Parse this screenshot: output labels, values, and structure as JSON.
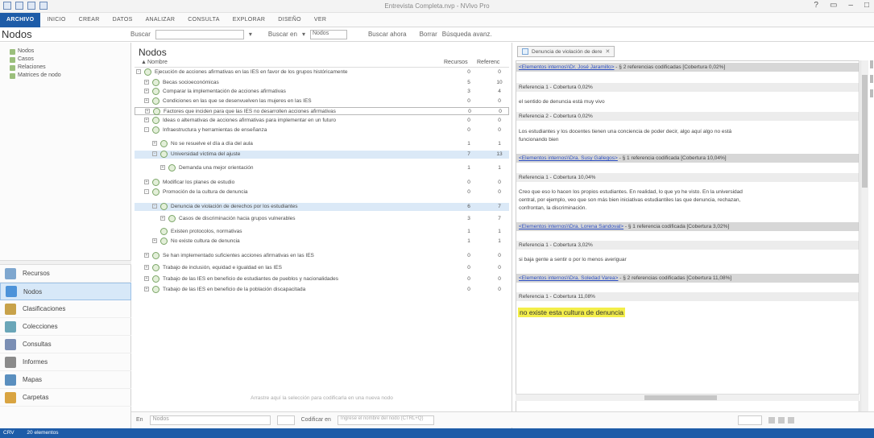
{
  "titlebar": {
    "title": "Entrevista Completa.nvp - NVivo Pro"
  },
  "ribbon": {
    "tabs": [
      "ARCHIVO",
      "INICIO",
      "CREAR",
      "DATOS",
      "ANALIZAR",
      "CONSULTA",
      "EXPLORAR",
      "DISEÑO",
      "VER"
    ]
  },
  "toolbar": {
    "heading": "Nodos",
    "search_label": "Buscar",
    "search_in_label": "Buscar en",
    "search_scope": "Nodos",
    "find_now": "Buscar ahora",
    "clear": "Borrar",
    "advanced": "Búsqueda avanz."
  },
  "leftnav": {
    "tree": [
      "Nodos",
      "Casos",
      "Relaciones",
      "Matrices de nodo"
    ],
    "nav": [
      "Recursos",
      "Nodos",
      "Clasificaciones",
      "Colecciones",
      "Consultas",
      "Informes",
      "Mapas",
      "Carpetas"
    ]
  },
  "center": {
    "title": "Nodos",
    "col_name": "Nombre",
    "col_resources": "Recursos",
    "col_references": "Referenc",
    "empty_hint": "Arrastre aquí la selección para codificarla en una nueva nodo",
    "bottom_label": "En",
    "bottom_value": "Nodos",
    "code_button": "Codificar en",
    "code_hint": "Ingrese el nombre del nodo (CTRL+Q)"
  },
  "nodes": [
    {
      "label": "Ejecución de acciones afirmativas en las IES en favor de los grupos históricamente",
      "res": "0",
      "ref": "0",
      "level": 0,
      "exp": "-"
    },
    {
      "label": "Becas socioeconómicas",
      "res": "5",
      "ref": "10",
      "level": 1,
      "exp": "+"
    },
    {
      "label": "Comparar la implementación de acciones afirmativas",
      "res": "3",
      "ref": "4",
      "level": 1,
      "exp": "+"
    },
    {
      "label": "Condiciones en las que se desenvuelven las mujeres en las IES",
      "res": "0",
      "ref": "0",
      "level": 1,
      "exp": "+"
    },
    {
      "label": "Factores que inciden para que las IES no desarrollen acciones afirmativas",
      "res": "0",
      "ref": "0",
      "level": 1,
      "exp": "+"
    },
    {
      "label": "Ideas o alternativas de acciones afirmativas para implementar en un futuro",
      "res": "0",
      "ref": "0",
      "level": 1,
      "exp": "+"
    },
    {
      "label": "Infraestructura y herramientas de enseñanza",
      "res": "0",
      "ref": "0",
      "level": 1,
      "exp": "-"
    },
    {
      "label": "No se resuelve el día a día del aula",
      "res": "1",
      "ref": "1",
      "level": 2,
      "exp": "+"
    },
    {
      "label": "Universidad víctima del ajuste",
      "res": "7",
      "ref": "13",
      "level": 2,
      "exp": "-"
    },
    {
      "label": "Demanda una mejor orientación",
      "res": "1",
      "ref": "1",
      "level": 3,
      "exp": "+"
    },
    {
      "label": "Modificar los planes de estudio",
      "res": "0",
      "ref": "0",
      "level": 1,
      "exp": "+"
    },
    {
      "label": "Promoción de la cultura de denuncia",
      "res": "0",
      "ref": "0",
      "level": 1,
      "exp": "-"
    },
    {
      "label": "Denuncia de violación de derechos por los estudiantes",
      "res": "6",
      "ref": "7",
      "level": 2,
      "exp": "-"
    },
    {
      "label": "Casos de discriminación hacia grupos vulnerables",
      "res": "3",
      "ref": "7",
      "level": 3,
      "exp": "+"
    },
    {
      "label": "Existen protocolos, normativas",
      "res": "1",
      "ref": "1",
      "level": 2,
      "exp": ""
    },
    {
      "label": "No existe cultura de denuncia",
      "res": "1",
      "ref": "1",
      "level": 2,
      "exp": "+"
    },
    {
      "label": "Se han implementado suficientes acciones afirmativas en las IES",
      "res": "0",
      "ref": "0",
      "level": 1,
      "exp": "+"
    },
    {
      "label": "Trabajo de inclusión, equidad e igualdad en las IES",
      "res": "0",
      "ref": "0",
      "level": 1,
      "exp": "+"
    },
    {
      "label": "Trabajo de las IES en beneficio de estudiantes de pueblos y nacionalidades",
      "res": "0",
      "ref": "0",
      "level": 1,
      "exp": "+"
    },
    {
      "label": "Trabajo de las IES en beneficio de la población discapacitada",
      "res": "0",
      "ref": "0",
      "level": 1,
      "exp": "+"
    }
  ],
  "right": {
    "tab_label": "Denuncia de violación de dere",
    "blocks": [
      {
        "type": "hdr",
        "link": "<Elementos internos\\\\Dr. José Jaramillo>",
        "rest": " - § 2 referencias codificadas  [Cobertura 0,02%]"
      },
      {
        "type": "ref",
        "text": "Referencia 1 - Cobertura 0,02%"
      },
      {
        "type": "txt",
        "text": "el sentido de denuncia está muy vivo"
      },
      {
        "type": "ref",
        "text": "Referencia 2 - Cobertura 0,02%"
      },
      {
        "type": "txt",
        "text": "Los estudiantes y los docentes tienen una conciencia de poder decir, algo aquí algo no está"
      },
      {
        "type": "txt",
        "text": "funcionando bien"
      },
      {
        "type": "hdr",
        "link": "<Elementos internos\\\\Dra. Susy Gallegos>",
        "rest": " - § 1 referencia codificada  [Cobertura 10,04%]"
      },
      {
        "type": "ref",
        "text": "Referencia 1 - Cobertura 10,04%"
      },
      {
        "type": "txt",
        "text": "Creo que eso lo hacen los propios estudiantes. En realidad, lo que yo he visto. En la universidad"
      },
      {
        "type": "txt",
        "text": "central, por ejemplo, veo que son más bien iniciativas estudiantiles las que denuncia, rechazan,"
      },
      {
        "type": "txt",
        "text": "confrontan, la discriminación."
      },
      {
        "type": "hdr",
        "link": "<Elementos internos\\\\Dra. Lorena Sandoval>",
        "rest": " - § 1 referencia codificada  [Cobertura 3,02%]"
      },
      {
        "type": "ref",
        "text": "Referencia 1 - Cobertura 3,02%"
      },
      {
        "type": "txt",
        "text": "si baja gente a sentir o por lo menos averiguar"
      },
      {
        "type": "hdr",
        "link": "<Elementos internos\\\\Dra. Soledad Varea>",
        "rest": " - § 2 referencias codificadas  [Cobertura 11,08%]"
      },
      {
        "type": "ref",
        "text": "Referencia 1 - Cobertura 11,08%"
      },
      {
        "type": "hl",
        "text": "no existe esta cultura de denuncia"
      }
    ]
  },
  "status": {
    "user": "CRV",
    "count": "20 elementos"
  }
}
